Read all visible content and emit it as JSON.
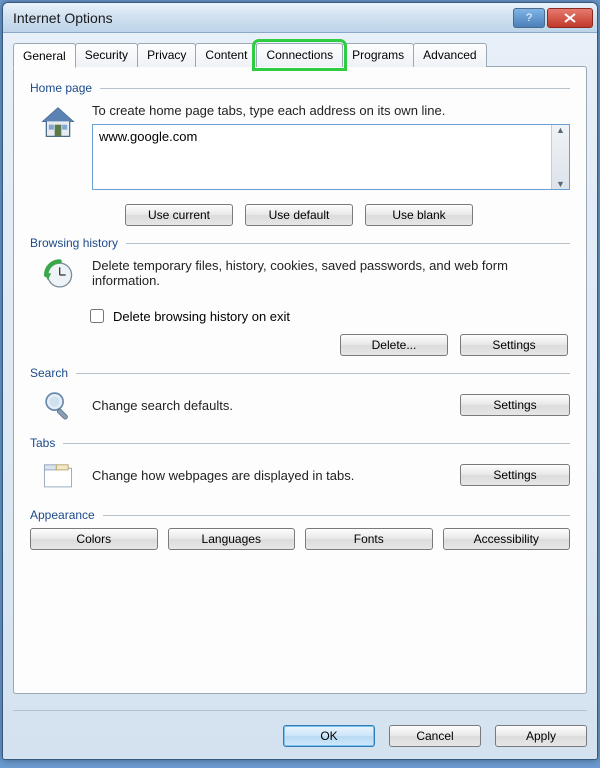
{
  "window": {
    "title": "Internet Options"
  },
  "tabs": [
    {
      "label": "General",
      "active": true
    },
    {
      "label": "Security"
    },
    {
      "label": "Privacy"
    },
    {
      "label": "Content"
    },
    {
      "label": "Connections",
      "highlighted": true
    },
    {
      "label": "Programs"
    },
    {
      "label": "Advanced"
    }
  ],
  "homepage": {
    "label": "Home page",
    "text": "To create home page tabs, type each address on its own line.",
    "value": "www.google.com",
    "use_current": "Use current",
    "use_default": "Use default",
    "use_blank": "Use blank"
  },
  "history": {
    "label": "Browsing history",
    "text": "Delete temporary files, history, cookies, saved passwords, and web form information.",
    "checkbox_label": "Delete browsing history on exit",
    "checkbox_checked": false,
    "delete": "Delete...",
    "settings": "Settings"
  },
  "search": {
    "label": "Search",
    "text": "Change search defaults.",
    "settings": "Settings"
  },
  "tabs_section": {
    "label": "Tabs",
    "text": "Change how webpages are displayed in tabs.",
    "settings": "Settings"
  },
  "appearance": {
    "label": "Appearance",
    "colors": "Colors",
    "languages": "Languages",
    "fonts": "Fonts",
    "accessibility": "Accessibility"
  },
  "footer": {
    "ok": "OK",
    "cancel": "Cancel",
    "apply": "Apply"
  }
}
